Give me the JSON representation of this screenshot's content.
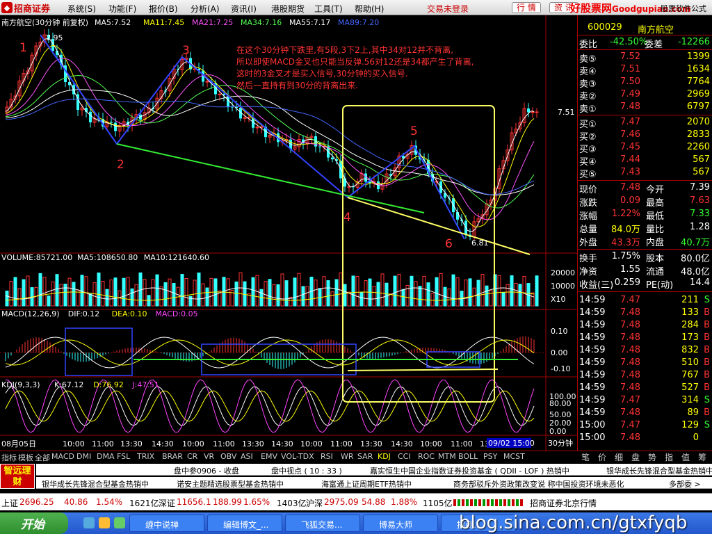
{
  "app": {
    "title": "招商证券",
    "menu": [
      "系统(S)",
      "功能(F)",
      "报价(B)",
      "分析(A)",
      "资讯(I)",
      "港股期货",
      "工具(T)",
      "帮助(H)"
    ],
    "trade_status": "交易未登录",
    "buttons": [
      "行 情",
      "资 讯"
    ],
    "watermark_main": "好股票网",
    "watermark_sub": "Goodgupiao.com",
    "soft_label": "股票软件公式"
  },
  "chart": {
    "header": "南方航空(30分钟 前复权)",
    "ma_labels": [
      {
        "text": "MA5:7.52",
        "color": "#ffffff"
      },
      {
        "text": "MA11:7.45",
        "color": "#ffff00"
      },
      {
        "text": "MA21:7.25",
        "color": "#ff55ff"
      },
      {
        "text": "MA34:7.16",
        "color": "#55ff55"
      },
      {
        "text": "MA55:7.17",
        "color": "#ffffff"
      },
      {
        "text": "MA89:7.20",
        "color": "#4466ff"
      }
    ],
    "price_high_label": "7.95",
    "price_low_label": "6.81",
    "right_price_label": "7.51",
    "annotation_lines": [
      "在这个30分钟下跌里,有5段,3下2上,其中34对12并不背离,",
      "所以即使MACD金叉也只能当反弹.56对12还是34都产生了背离,",
      "这时的3金叉才是买入信号,30分钟的买入信号.",
      "然后一直持有到30分的背离出来."
    ],
    "wave_numbers": [
      "1",
      "2",
      "3",
      "4",
      "5",
      "6"
    ],
    "volume_header": [
      "VOLUME:85721.00",
      "MA5:108650.80",
      "MA10:121640.60"
    ],
    "volume_ticks": [
      "20000",
      "10000",
      "X10"
    ],
    "macd_header": [
      "MACD(12,26,9)",
      "DIF:0.12",
      "DEA:0.10",
      "MACD:0.05"
    ],
    "macd_ticks": [
      "0.10",
      "0.00",
      "-0.10"
    ],
    "kdj_header": [
      "KDJ(9,3,3)",
      "K:67.12",
      "D:76.92",
      "J:47.51"
    ],
    "kdj_ticks": [
      "100.00",
      "80.00",
      "50.00",
      "20.00",
      "0.00"
    ],
    "time_axis": [
      "08月05日",
      "10:00",
      "11:00",
      "13:30",
      "14:30",
      "10:00",
      "11:00",
      "13:30",
      "14:30",
      "10:00",
      "11:00",
      "13:30",
      "14:30",
      "10:00",
      "11:00",
      "13:30",
      "14:30",
      "10:00",
      "11:00",
      "13"
    ],
    "cursor_time": "09/02 15:00",
    "period": "30分钟"
  },
  "tabs": [
    "指标",
    "模板",
    "全部",
    "MACD",
    "DMI",
    "DMA",
    "FSL",
    "TRIX",
    "BRAR",
    "CR",
    "VR",
    "OBV",
    "ASI",
    "EMV",
    "VOL-TDX",
    "RSI",
    "WR",
    "SAR",
    "KDJ",
    "CCI",
    "ROC",
    "MTM",
    "BOLL",
    "PSY",
    "MCST"
  ],
  "side": {
    "code": "600029",
    "name": "南方航空",
    "weibi_label": "委比",
    "weibi": "-42.50%",
    "weicha_label": "委差",
    "weicha": "-12266",
    "sells": [
      {
        "label": "卖⑤",
        "price": "7.52",
        "vol": "1399"
      },
      {
        "label": "卖④",
        "price": "7.51",
        "vol": "1634"
      },
      {
        "label": "卖③",
        "price": "7.50",
        "vol": "7764"
      },
      {
        "label": "卖②",
        "price": "7.49",
        "vol": "2969"
      },
      {
        "label": "卖①",
        "price": "7.48",
        "vol": "6797"
      }
    ],
    "buys": [
      {
        "label": "买①",
        "price": "7.47",
        "vol": "2070"
      },
      {
        "label": "买②",
        "price": "7.46",
        "vol": "2833"
      },
      {
        "label": "买③",
        "price": "7.45",
        "vol": "2260"
      },
      {
        "label": "买④",
        "price": "7.44",
        "vol": "567"
      },
      {
        "label": "买⑤",
        "price": "7.43",
        "vol": "567"
      }
    ],
    "quote": [
      {
        "l1": "现价",
        "v1": "7.48",
        "l2": "今开",
        "v2": "7.39",
        "c1": "#ff3333",
        "c2": "#ffffff"
      },
      {
        "l1": "涨跌",
        "v1": "0.09",
        "l2": "最高",
        "v2": "7.63",
        "c1": "#ff3333",
        "c2": "#ff3333"
      },
      {
        "l1": "涨幅",
        "v1": "1.22%",
        "l2": "最低",
        "v2": "7.33",
        "c1": "#ff3333",
        "c2": "#33ff33"
      },
      {
        "l1": "总量",
        "v1": "84.0万",
        "l2": "量比",
        "v2": "1.28",
        "c1": "#ffff00",
        "c2": "#ffffff"
      },
      {
        "l1": "外盘",
        "v1": "43.3万",
        "l2": "内盘",
        "v2": "40.7万",
        "c1": "#ff3333",
        "c2": "#33ff33"
      }
    ],
    "stats": [
      {
        "l1": "换手",
        "v1": "1.75%",
        "l2": "股本",
        "v2": "80.0亿"
      },
      {
        "l1": "净资",
        "v1": "1.55",
        "l2": "流通",
        "v2": "48.0亿"
      },
      {
        "l1": "收益(三)",
        "v1": "0.259",
        "l2": "PE(动)",
        "v2": "14.4"
      }
    ],
    "ticks": [
      {
        "time": "14:59",
        "price": "7.47",
        "vol": "211",
        "dir": "S"
      },
      {
        "time": "14:59",
        "price": "7.48",
        "vol": "133",
        "dir": "B"
      },
      {
        "time": "14:59",
        "price": "7.48",
        "vol": "284",
        "dir": "B"
      },
      {
        "time": "14:59",
        "price": "7.48",
        "vol": "173",
        "dir": "B"
      },
      {
        "time": "14:59",
        "price": "7.48",
        "vol": "832",
        "dir": "B"
      },
      {
        "time": "14:59",
        "price": "7.48",
        "vol": "510",
        "dir": "B"
      },
      {
        "time": "14:59",
        "price": "7.48",
        "vol": "767",
        "dir": "B"
      },
      {
        "time": "14:59",
        "price": "7.48",
        "vol": "527",
        "dir": "B"
      },
      {
        "time": "14:59",
        "price": "7.47",
        "vol": "314",
        "dir": "S"
      },
      {
        "time": "14:59",
        "price": "7.48",
        "vol": "89",
        "dir": "B"
      },
      {
        "time": "15:00",
        "price": "7.47",
        "vol": "129",
        "dir": "S"
      },
      {
        "time": "15:00",
        "price": "7.48",
        "vol": "0",
        "dir": ""
      }
    ],
    "tabs": [
      "笔",
      "价",
      "细",
      "盘",
      "势",
      "指",
      "值",
      "筹"
    ]
  },
  "ticker1": [
    "盘中参0906 - 收盘",
    "盘中视点 ( 10 : 33 )",
    "嘉实恒生中国企业指数证券投资基金 ( QDII - LOF ) 热销中",
    "银华成长先锋混合型基金热销中"
  ],
  "ticker2": [
    "银华成长先锋混合型基金热销中",
    "诺安主题精选股票型基金热销中",
    "海富通上证周期ETF热销中",
    "商务部驳斥外资政策改变说 称中国投资环境未恶化",
    "多部委 >"
  ],
  "ad": "智远理财",
  "indices": {
    "sh_label": "上证",
    "sh_val": "2696.25",
    "sh_chg": "40.86",
    "sh_pct": "1.54%",
    "sh_amt": "1621亿",
    "sz_label": "深证",
    "sz_val": "11656.1",
    "sz_chg": "188.99",
    "sz_pct": "1.65%",
    "sz_amt": "1403亿",
    "hs_label": "沪深",
    "hs_val": "2975.09",
    "hs_chg": "54.88",
    "hs_pct": "1.88%",
    "hs_amt": "1105亿",
    "broker": "招商证券北京行情"
  },
  "taskbar": {
    "start": "开始",
    "tasks": [
      "缠中说禅",
      "编辑博文_...",
      "飞狐交易...",
      "博易大师",
      "招商..."
    ],
    "blog": "blog.sina.com.cn/gtxfyqb"
  },
  "colors": {
    "up": "#ff3333",
    "down": "#33ffff",
    "bg": "#000000",
    "grid": "#a00000"
  }
}
